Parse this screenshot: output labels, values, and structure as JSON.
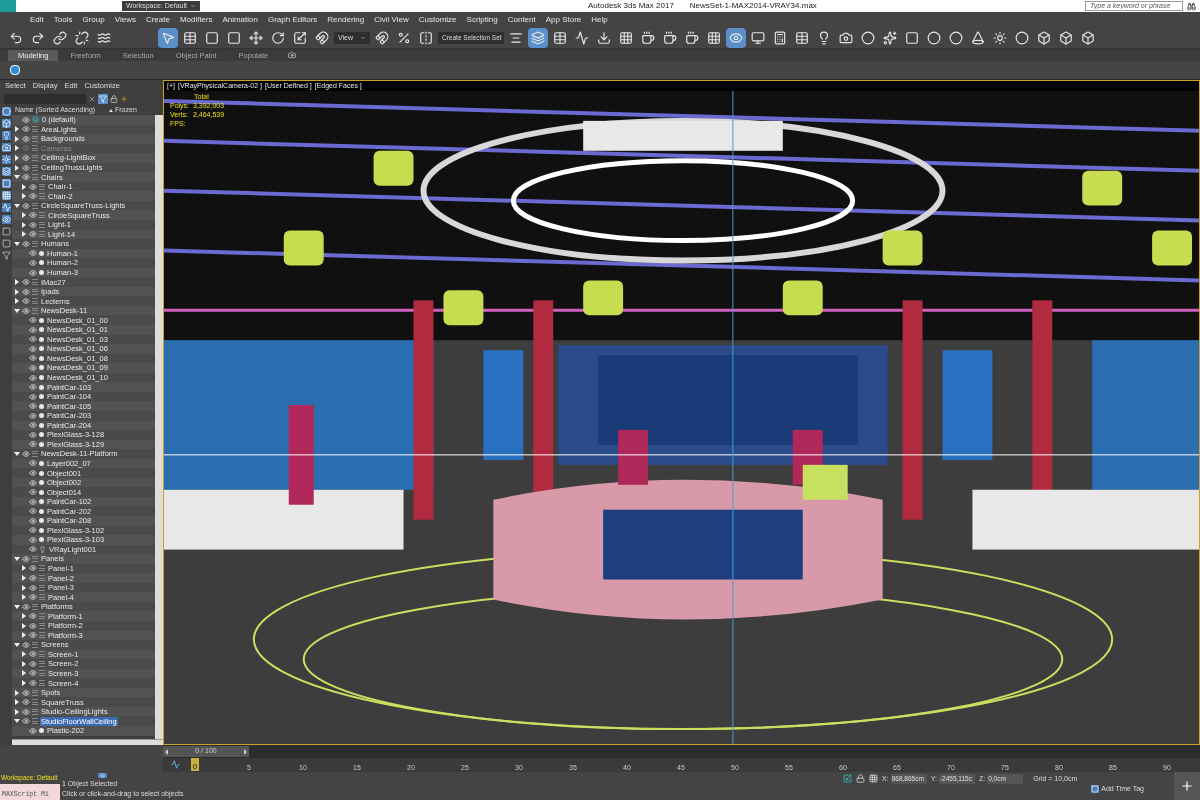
{
  "window": {
    "title": "Autodesk 3ds Max 2017",
    "file": "NewsSet-1-MAX2014-VRAY34.max",
    "search": {
      "placeholder": "Type a keyword or phrase"
    },
    "workspace": "Workspace: Default"
  },
  "menu": [
    "Edit",
    "Tools",
    "Group",
    "Views",
    "Create",
    "Modifiers",
    "Animation",
    "Graph Editors",
    "Rendering",
    "Civil View",
    "Customize",
    "Scripting",
    "Content",
    "App Store",
    "Help"
  ],
  "toolbar": {
    "view_dropdown": "View",
    "selection_set_dropdown": "Create Selection Set"
  },
  "ribbon_tabs": [
    {
      "label": "Modeling",
      "selected": true
    },
    {
      "label": "Freeform",
      "selected": false
    },
    {
      "label": "Selection",
      "selected": false
    },
    {
      "label": "Object Paint",
      "selected": false
    },
    {
      "label": "Populate",
      "selected": false
    }
  ],
  "scene_explorer": {
    "menu": [
      "Select",
      "Display",
      "Edit",
      "Customize"
    ],
    "columns": [
      "Name (Sorted Ascending)",
      "Frozen"
    ],
    "tree": [
      {
        "name": "0 (default)",
        "kind": "default",
        "visible": true,
        "selected": false
      },
      {
        "name": "AreaLights",
        "kind": "layer",
        "visible": true,
        "expanded": false,
        "selected": false
      },
      {
        "name": "Backgrounds",
        "kind": "layer",
        "visible": true,
        "expanded": false,
        "selected": false
      },
      {
        "name": "Cameras",
        "kind": "layer",
        "visible": false,
        "expanded": false,
        "selected": false
      },
      {
        "name": "Ceiling-LightBox",
        "kind": "layer",
        "visible": true,
        "expanded": false,
        "selected": false
      },
      {
        "name": "CeilingTrussLights",
        "kind": "layer",
        "visible": true,
        "expanded": false,
        "selected": false
      },
      {
        "name": "Chairs",
        "kind": "layer",
        "visible": true,
        "expanded": true,
        "selected": false,
        "children": [
          {
            "name": "Chair-1",
            "kind": "layer",
            "visible": true,
            "expanded": false,
            "selected": false
          },
          {
            "name": "Chair-2",
            "kind": "layer",
            "visible": true,
            "expanded": false,
            "selected": false
          }
        ]
      },
      {
        "name": "CircleSquareTruss-Lights",
        "kind": "layer",
        "visible": true,
        "expanded": true,
        "selected": false,
        "children": [
          {
            "name": "CircleSquareTruss",
            "kind": "layer",
            "visible": true,
            "expanded": false,
            "selected": false
          },
          {
            "name": "Light-1",
            "kind": "layer",
            "visible": true,
            "expanded": false,
            "selected": false
          },
          {
            "name": "Light-14",
            "kind": "layer",
            "visible": true,
            "expanded": false,
            "selected": false
          }
        ]
      },
      {
        "name": "Humans",
        "kind": "layer",
        "visible": true,
        "expanded": true,
        "selected": false,
        "children": [
          {
            "name": "Human-1",
            "kind": "object",
            "visible": true,
            "selected": false
          },
          {
            "name": "Human-2",
            "kind": "object",
            "visible": true,
            "selected": false
          },
          {
            "name": "Human-3",
            "kind": "object",
            "visible": true,
            "selected": false
          }
        ]
      },
      {
        "name": "IMac27",
        "kind": "layer",
        "visible": true,
        "expanded": false,
        "selected": false
      },
      {
        "name": "Ipads",
        "kind": "layer",
        "visible": true,
        "expanded": false,
        "selected": false
      },
      {
        "name": "Lecterns",
        "kind": "layer",
        "visible": true,
        "expanded": false,
        "selected": false
      },
      {
        "name": "NewsDesk-11",
        "kind": "layer",
        "visible": true,
        "expanded": true,
        "selected": false,
        "children": [
          {
            "name": "NewsDesk_01_00",
            "kind": "object",
            "visible": true,
            "selected": false
          },
          {
            "name": "NewsDesk_01_01",
            "kind": "object",
            "visible": true,
            "selected": false
          },
          {
            "name": "NewsDesk_01_03",
            "kind": "object",
            "visible": true,
            "selected": false
          },
          {
            "name": "NewsDesk_01_06",
            "kind": "object",
            "visible": true,
            "selected": false
          },
          {
            "name": "NewsDesk_01_08",
            "kind": "object",
            "visible": true,
            "selected": false
          },
          {
            "name": "NewsDesk_01_09",
            "kind": "object",
            "visible": true,
            "selected": false
          },
          {
            "name": "NewsDesk_01_10",
            "kind": "object",
            "visible": true,
            "selected": false
          },
          {
            "name": "PaintCar-103",
            "kind": "object",
            "visible": true,
            "selected": false
          },
          {
            "name": "PaintCar-104",
            "kind": "object",
            "visible": true,
            "selected": false
          },
          {
            "name": "PaintCar-105",
            "kind": "object",
            "visible": true,
            "selected": false
          },
          {
            "name": "PaintCar-203",
            "kind": "object",
            "visible": true,
            "selected": false
          },
          {
            "name": "PaintCar-204",
            "kind": "object",
            "visible": true,
            "selected": false
          },
          {
            "name": "PlexiGlass-3-128",
            "kind": "object",
            "visible": true,
            "selected": false
          },
          {
            "name": "PlexiGlass-3-129",
            "kind": "object",
            "visible": true,
            "selected": false
          }
        ]
      },
      {
        "name": "NewsDesk-11-Platform",
        "kind": "layer",
        "visible": true,
        "expanded": true,
        "selected": false,
        "children": [
          {
            "name": "Layer002_07",
            "kind": "object",
            "visible": true,
            "selected": false
          },
          {
            "name": "Object001",
            "kind": "object",
            "visible": true,
            "selected": false
          },
          {
            "name": "Object002",
            "kind": "object",
            "visible": true,
            "selected": false
          },
          {
            "name": "Object014",
            "kind": "object",
            "visible": true,
            "selected": false
          },
          {
            "name": "PaintCar-102",
            "kind": "object",
            "visible": true,
            "selected": false
          },
          {
            "name": "PaintCar-202",
            "kind": "object",
            "visible": true,
            "selected": false
          },
          {
            "name": "PaintCar-208",
            "kind": "object",
            "visible": true,
            "selected": false
          },
          {
            "name": "PlexiGlass-3-102",
            "kind": "object",
            "visible": true,
            "selected": false
          },
          {
            "name": "PlexiGlass-3-103",
            "kind": "object",
            "visible": true,
            "selected": false
          },
          {
            "name": "VRayLight001",
            "kind": "light",
            "visible": true,
            "selected": false
          }
        ]
      },
      {
        "name": "Panels",
        "kind": "layer",
        "visible": true,
        "expanded": true,
        "selected": false,
        "children": [
          {
            "name": "Panel-1",
            "kind": "layer",
            "visible": true,
            "expanded": false,
            "selected": false
          },
          {
            "name": "Panel-2",
            "kind": "layer",
            "visible": true,
            "expanded": false,
            "selected": false
          },
          {
            "name": "Panel-3",
            "kind": "layer",
            "visible": true,
            "expanded": false,
            "selected": false
          },
          {
            "name": "Panel-4",
            "kind": "layer",
            "visible": true,
            "expanded": false,
            "selected": false
          }
        ]
      },
      {
        "name": "Platforms",
        "kind": "layer",
        "visible": true,
        "expanded": true,
        "selected": false,
        "children": [
          {
            "name": "Platform-1",
            "kind": "layer",
            "visible": true,
            "expanded": false,
            "selected": false
          },
          {
            "name": "Platform-2",
            "kind": "layer",
            "visible": true,
            "expanded": false,
            "selected": false
          },
          {
            "name": "Platform-3",
            "kind": "layer",
            "visible": true,
            "expanded": false,
            "selected": false
          }
        ]
      },
      {
        "name": "Screens",
        "kind": "layer",
        "visible": true,
        "expanded": true,
        "selected": false,
        "children": [
          {
            "name": "Screen-1",
            "kind": "layer",
            "visible": true,
            "expanded": false,
            "selected": false
          },
          {
            "name": "Screen-2",
            "kind": "layer",
            "visible": true,
            "expanded": false,
            "selected": false
          },
          {
            "name": "Screen-3",
            "kind": "layer",
            "visible": true,
            "expanded": false,
            "selected": false
          },
          {
            "name": "Screen-4",
            "kind": "layer",
            "visible": true,
            "expanded": false,
            "selected": false
          }
        ]
      },
      {
        "name": "Spots",
        "kind": "layer",
        "visible": true,
        "expanded": false,
        "selected": false
      },
      {
        "name": "SquareTruss",
        "kind": "layer",
        "visible": true,
        "expanded": false,
        "selected": false
      },
      {
        "name": "Studio-CeilingLights",
        "kind": "layer",
        "visible": true,
        "expanded": false,
        "selected": false
      },
      {
        "name": "StudioFloorWallCeiling",
        "kind": "layer",
        "visible": true,
        "expanded": true,
        "selected": true,
        "children": [
          {
            "name": "Plastic-202",
            "kind": "object",
            "visible": true,
            "selected": false
          }
        ]
      }
    ]
  },
  "viewport": {
    "labels": [
      "[+]",
      "[VRayPhysicalCamera-02 ]",
      "[User Defined ]",
      "[Edged Faces ]"
    ],
    "stats_title": "Total",
    "stats": [
      {
        "label": "Polys:",
        "value": "3,392,003"
      },
      {
        "label": "Verts:",
        "value": "2,464,539"
      },
      {
        "label": "FPS:"
      }
    ]
  },
  "timeline": {
    "slider": {
      "label": "0 / 100",
      "level": 0
    },
    "current": "0",
    "ticks": [
      "5",
      "10",
      "15",
      "20",
      "25",
      "30",
      "35",
      "40",
      "45",
      "50",
      "55",
      "60",
      "65",
      "70",
      "75",
      "80",
      "85",
      "90"
    ]
  },
  "status": {
    "workspace": "Workspace: Default",
    "listener": "MAXScript Mi",
    "selection": "1 Object Selected",
    "prompt": "Click or click-and-drag to select objects",
    "coords": [
      {
        "label": "X:",
        "value": "868,865cm"
      },
      {
        "label": "Y:",
        "value": "-2455,115c"
      },
      {
        "label": "Z:",
        "value": "0,0cm"
      }
    ],
    "grid": "Grid = 10,0cm",
    "time_tag": "Add Time Tag"
  }
}
